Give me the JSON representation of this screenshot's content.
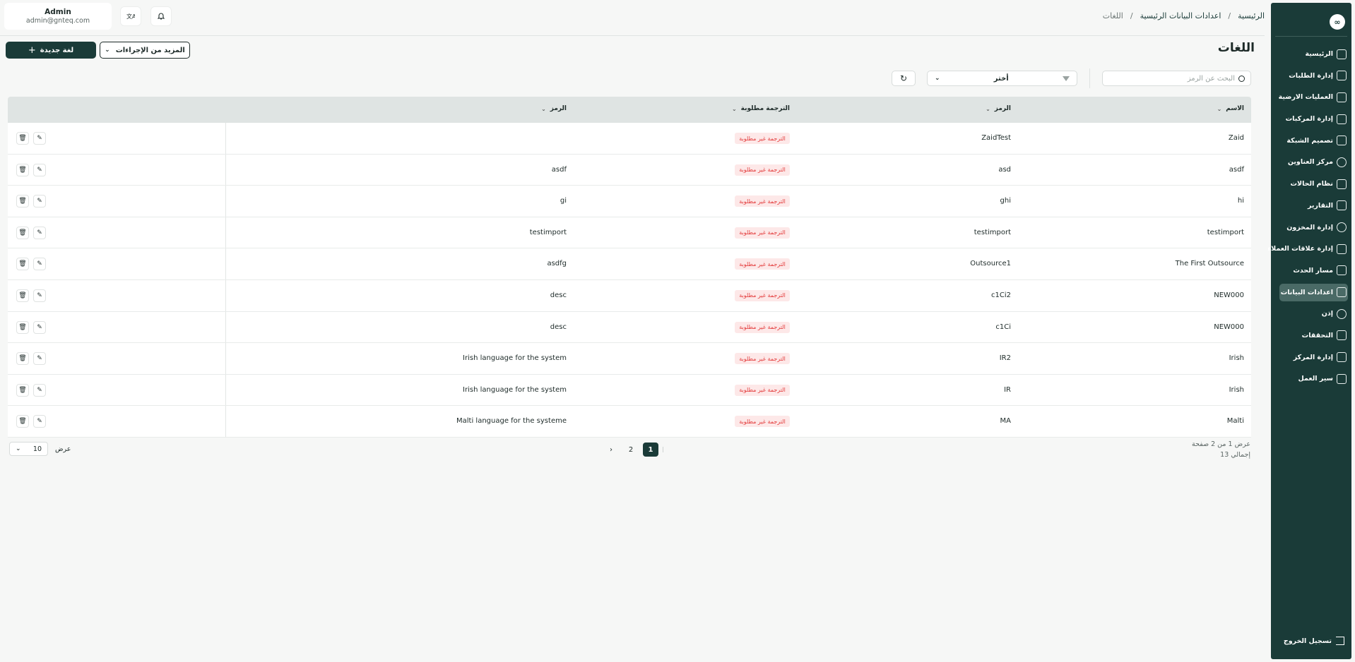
{
  "user": {
    "name": "Admin",
    "email": "admin@gnteq.com"
  },
  "header": {
    "breadcrumb": [
      {
        "label": "الرئيسية"
      },
      {
        "label": "اعدادات البيانات الرئيسية"
      },
      {
        "label": "اللغات"
      }
    ],
    "sep": "/"
  },
  "page": {
    "title": "اللغات",
    "new_button": "لغة جديدة",
    "more_button": "المزيد من الإجراءات",
    "search_placeholder": "البحث عن الرمز",
    "select_value": "أختر"
  },
  "sidebar": {
    "logo": "∞",
    "items": [
      {
        "label": "الرئيسية"
      },
      {
        "label": "إدارة الطلبات"
      },
      {
        "label": "العمليات الارضية"
      },
      {
        "label": "إدارة المركبات"
      },
      {
        "label": "تصميم الشبكة"
      },
      {
        "label": "مركز العناوين"
      },
      {
        "label": "نظام الحالات"
      },
      {
        "label": "التقارير"
      },
      {
        "label": "إدارة المخزون"
      },
      {
        "label": "إدارة علاقات العملاء"
      },
      {
        "label": "مسار الحدث"
      },
      {
        "label": "اعدادات البيانات"
      },
      {
        "label": "إذن"
      },
      {
        "label": "التحققات"
      },
      {
        "label": "إدارة المركز"
      },
      {
        "label": "سير العمل"
      }
    ],
    "active_index": 11,
    "logout": "تسجيل الخروج"
  },
  "table": {
    "columns": {
      "name": "الاسم",
      "code": "الرمز",
      "translation": "الترجمة مطلوبة",
      "description": "الرمز"
    },
    "rows": [
      {
        "name": "Zaid",
        "code": "ZaidTest",
        "badge": "الترجمة غير مطلوبة",
        "description": ""
      },
      {
        "name": "asdf",
        "code": "asd",
        "badge": "الترجمة غير مطلوبة",
        "description": "asdf"
      },
      {
        "name": "hi",
        "code": "ghi",
        "badge": "الترجمة غير مطلوبة",
        "description": "gi"
      },
      {
        "name": "testimport",
        "code": "testimport",
        "badge": "الترجمة غير مطلوبة",
        "description": "testimport"
      },
      {
        "name": "The First Outsource",
        "code": "Outsource1",
        "badge": "الترجمة غير مطلوبة",
        "description": "asdfg"
      },
      {
        "name": "NEW000",
        "code": "c1Ci2",
        "badge": "الترجمة غير مطلوبة",
        "description": "desc"
      },
      {
        "name": "NEW000",
        "code": "c1Ci",
        "badge": "الترجمة غير مطلوبة",
        "description": "desc"
      },
      {
        "name": "Irish",
        "code": "IR2",
        "badge": "الترجمة غير مطلوبة",
        "description": "Irish language for the system"
      },
      {
        "name": "Irish",
        "code": "IR",
        "badge": "الترجمة غير مطلوبة",
        "description": "Irish language for the system"
      },
      {
        "name": "Malti",
        "code": "MA",
        "badge": "الترجمة غير مطلوبة",
        "description": "Malti language for the systeme"
      }
    ]
  },
  "pagination": {
    "info_line1": "عرض 1 من 2 صفحة",
    "info_line2": "إجمالي 13",
    "pages": [
      "1",
      "2"
    ],
    "current": "1",
    "next": "›",
    "per_page_label": "عرض",
    "per_page_value": "10"
  }
}
